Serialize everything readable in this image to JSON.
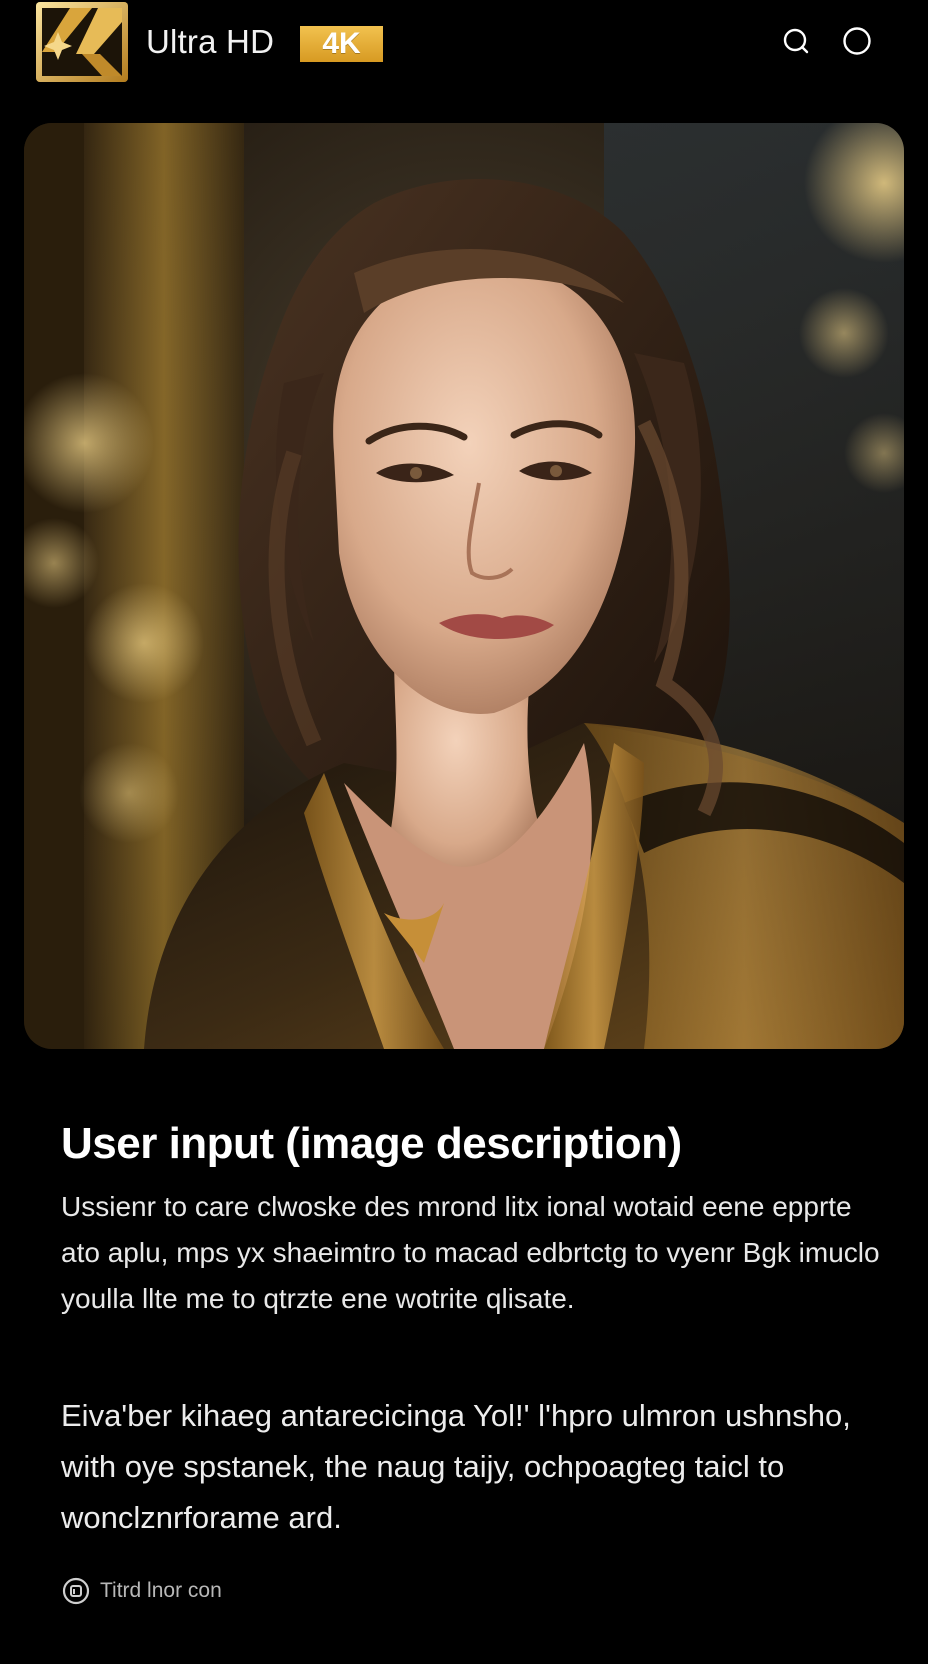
{
  "header": {
    "title": "Ultra HD",
    "badge": "4K",
    "icons": [
      "logo-icon",
      "search-icon",
      "profile-icon"
    ],
    "badge_color": "#e0a82e"
  },
  "hero": {
    "icon": "portrait-image"
  },
  "content": {
    "heading": "User input (image description)",
    "paragraph_1": "Ussienr to care clwoske des mrond litx ional wotaid eene epprte ato aplu, mps yx shaeimtro to macad edbrtctg to vyenr Bgk imuclo youlla llte me to qtrzte ene wotrite qlisate.",
    "paragraph_2": "Eiva'ber kihaeg antarecicinga Yol!' l'hpro ulmron ushnsho, with oye spstanek, the naug taijy, ochpoagteg taicl to wonclznrforame ard.",
    "footer_note": "Titrd lnor con"
  }
}
